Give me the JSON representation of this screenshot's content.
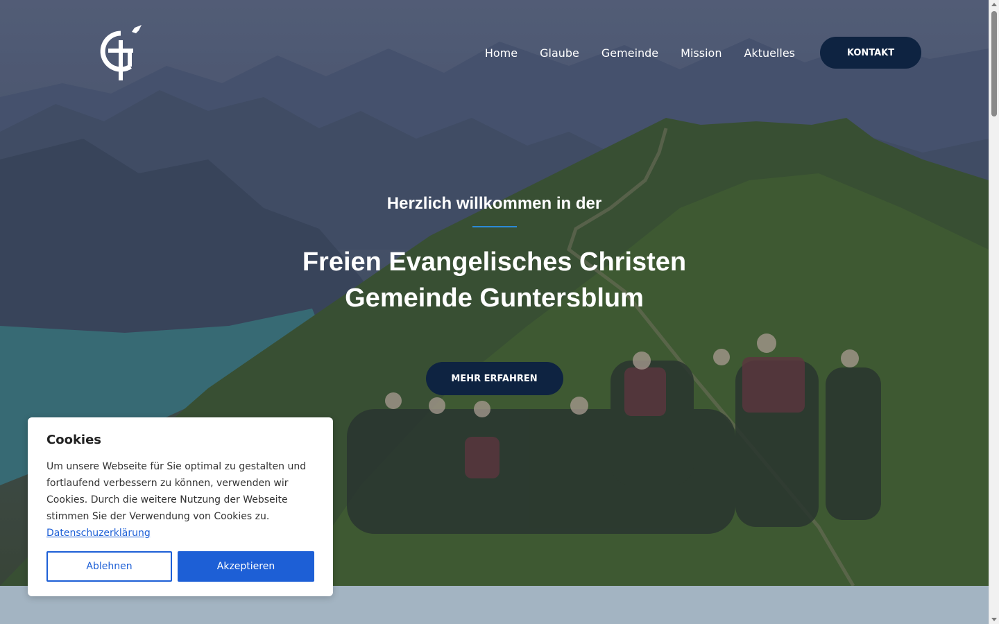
{
  "nav": {
    "items": [
      {
        "label": "Home"
      },
      {
        "label": "Glaube"
      },
      {
        "label": "Gemeinde"
      },
      {
        "label": "Mission"
      },
      {
        "label": "Aktuelles"
      }
    ],
    "contact_label": "KONTAKT"
  },
  "hero": {
    "welcome": "Herzlich willkommen in der",
    "title_line1": "Freien Evangelisches Christen",
    "title_line2": "Gemeinde Guntersblum",
    "cta_label": "MEHR ERFAHREN"
  },
  "cookie": {
    "title": "Cookies",
    "text": "Um unsere Webseite für Sie optimal zu gestalten und fortlaufend verbessern zu können, verwenden wir Cookies. Durch die weitere Nutzung der Webseite stimmen Sie der Verwendung von Cookies zu.",
    "privacy_link": "Datenschuzerklärung",
    "decline_label": "Ablehnen",
    "accept_label": "Akzeptieren"
  },
  "colors": {
    "navy": "#0e2341",
    "accent_blue": "#1d5fd6",
    "divider_blue": "#2b8ad7",
    "band": "#a3b4c2"
  },
  "icons": {
    "logo": "cross-with-dove-logo"
  }
}
